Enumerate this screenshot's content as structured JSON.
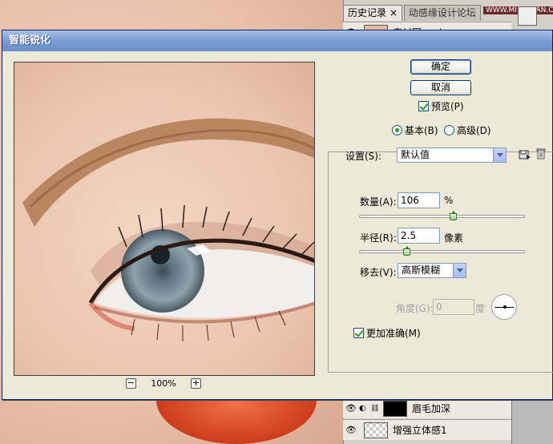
{
  "background": {
    "tabs": [
      {
        "label": "历史记录",
        "close": "×"
      },
      {
        "label": "动感缘设计论坛"
      }
    ],
    "watermark": "WWW.MISSYUAN.COM",
    "layers": [
      {
        "name": "素材图.psd"
      },
      {
        "name": "眉毛加深"
      },
      {
        "name": "增强立体感1"
      }
    ]
  },
  "dialog": {
    "title": "智能锐化",
    "ok_label": "确定",
    "cancel_label": "取消",
    "preview_label": "预览(P)",
    "preview_checked": true,
    "mode": {
      "basic_label": "基本(B)",
      "advanced_label": "高级(D)",
      "selected": "basic"
    },
    "zoom": {
      "value": "100%",
      "minus": "−",
      "plus": "+"
    },
    "settings": {
      "label": "设置(S):",
      "value": "默认值"
    },
    "amount": {
      "label": "数量(A):",
      "value": "106",
      "unit": "%",
      "slider_fraction": 0.56
    },
    "radius": {
      "label": "半径(R):",
      "value": "2.5",
      "unit": "像素",
      "slider_fraction": 0.28
    },
    "remove": {
      "label": "移去(V):",
      "value": "高斯模糊"
    },
    "angle": {
      "label": "角度(G):",
      "value": "0",
      "unit": "度"
    },
    "more_accurate": {
      "label": "更加准确(M)",
      "checked": true
    }
  },
  "colors": {
    "titlebar": "#7a9cd4",
    "dialog_bg": "#ece9d8",
    "check_green": "#21a121"
  }
}
